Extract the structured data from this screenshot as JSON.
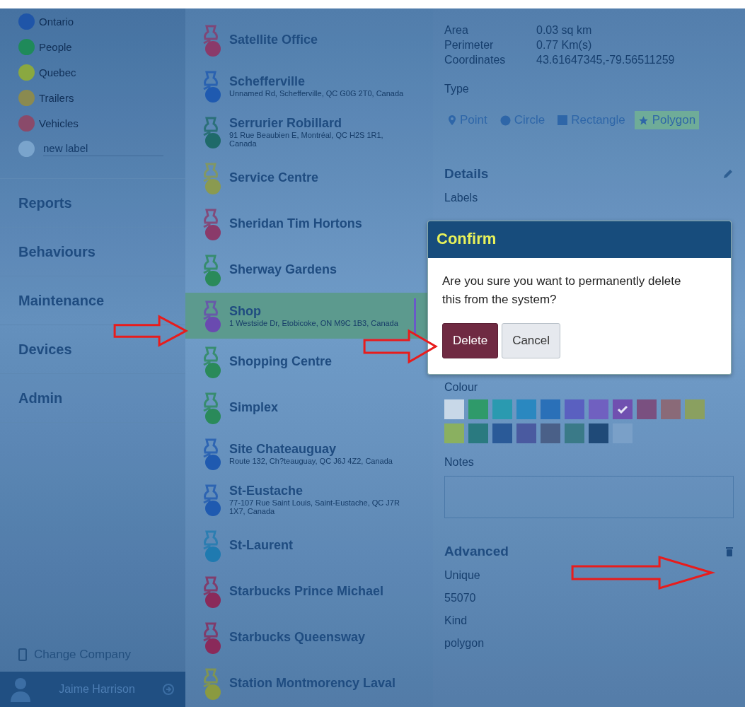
{
  "labels": [
    {
      "name": "Ontario",
      "color": "#1f55a8"
    },
    {
      "name": "People",
      "color": "#1f8a5a"
    },
    {
      "name": "Quebec",
      "color": "#8aa840"
    },
    {
      "name": "Trailers",
      "color": "#8a8a50"
    },
    {
      "name": "Vehicles",
      "color": "#8a4a6a"
    }
  ],
  "new_label": {
    "placeholder": "new label"
  },
  "nav": [
    "Reports",
    "Behaviours",
    "Maintenance",
    "Devices",
    "Admin"
  ],
  "change_company": "Change Company",
  "user": {
    "name": "Jaime Harrison"
  },
  "places": [
    {
      "name": "Satellite Office",
      "color": "#8a3a6a",
      "selected": false
    },
    {
      "name": "Schefferville",
      "address": "Unnamed Rd, Schefferville, QC G0G 2T0, Canada",
      "color": "#1f5ab0",
      "selected": false
    },
    {
      "name": "Serrurier Robillard",
      "address": "91 Rue Beaubien E, Montréal, QC H2S 1R1, Canada",
      "color": "#1f6a6a",
      "selected": false
    },
    {
      "name": "Service Centre",
      "color": "#8a9a50",
      "selected": false
    },
    {
      "name": "Sheridan Tim Hortons",
      "color": "#8a3a6a",
      "selected": false
    },
    {
      "name": "Sherway Gardens",
      "color": "#2a8a5a",
      "selected": false
    },
    {
      "name": "Shop",
      "address": "1 Westside Dr, Etobicoke, ON M9C 1B3, Canada",
      "color": "#6a4ab0",
      "selected": true
    },
    {
      "name": "Shopping Centre",
      "color": "#2a8a5a",
      "selected": false
    },
    {
      "name": "Simplex",
      "color": "#2a8a5a",
      "selected": false
    },
    {
      "name": "Site Chateauguay",
      "address": "Route 132, Ch?teauguay, QC J6J 4Z2, Canada",
      "color": "#1f5ab0",
      "selected": false
    },
    {
      "name": "St-Eustache",
      "address": "77-107 Rue Saint Louis, Saint-Eustache, QC J7R 1X7, Canada",
      "color": "#1f5ab0",
      "selected": false
    },
    {
      "name": "St-Laurent",
      "color": "#1f7ab0",
      "selected": false
    },
    {
      "name": "Starbucks Prince Michael",
      "color": "#8a2a5a",
      "selected": false
    },
    {
      "name": "Starbucks Queensway",
      "color": "#8a2a5a",
      "selected": false
    },
    {
      "name": "Station Montmorency Laval",
      "color": "#8a9a40",
      "selected": false
    }
  ],
  "stats": [
    {
      "label": "Area",
      "value": "0.03 sq km"
    },
    {
      "label": "Perimeter",
      "value": "0.77 Km(s)"
    },
    {
      "label": "Coordinates",
      "value": "43.61647345,-79.56511259"
    }
  ],
  "type": {
    "label": "Type",
    "options": [
      {
        "label": "Point",
        "kind": "pin",
        "selected": false
      },
      {
        "label": "Circle",
        "kind": "circle",
        "selected": false
      },
      {
        "label": "Rectangle",
        "kind": "square",
        "selected": false
      },
      {
        "label": "Polygon",
        "kind": "star",
        "selected": true
      }
    ]
  },
  "details": {
    "title": "Details",
    "labels_label": "Labels",
    "colour_label": "Colour",
    "swatches": [
      {
        "color": "#c8d8e8",
        "selected": false
      },
      {
        "color": "#2f9a6a",
        "selected": false
      },
      {
        "color": "#2a9ab0",
        "selected": false
      },
      {
        "color": "#2a88c0",
        "selected": false
      },
      {
        "color": "#2a70b8",
        "selected": false
      },
      {
        "color": "#5a60c0",
        "selected": false
      },
      {
        "color": "#7060c0",
        "selected": false
      },
      {
        "color": "#7050b0",
        "selected": true
      },
      {
        "color": "#7a5080",
        "selected": false
      },
      {
        "color": "#8a6a78",
        "selected": false
      },
      {
        "color": "#8aa060",
        "selected": false
      },
      {
        "color": "#8ab060",
        "selected": false
      },
      {
        "color": "#2a7a80",
        "selected": false
      },
      {
        "color": "#2a5a98",
        "selected": false
      },
      {
        "color": "#4a5aa0",
        "selected": false
      },
      {
        "color": "#4a6088",
        "selected": false
      },
      {
        "color": "#3a7a88",
        "selected": false
      },
      {
        "color": "#1f4a78",
        "selected": false
      },
      {
        "color": "#7aa0c8",
        "selected": false
      }
    ],
    "notes_label": "Notes"
  },
  "advanced": {
    "title": "Advanced",
    "fields": [
      {
        "label": "Unique",
        "value": "55070"
      },
      {
        "label": "Kind",
        "value": "polygon"
      }
    ]
  },
  "dialog": {
    "title": "Confirm",
    "message": "Are you sure you want to permanently delete this from the system?",
    "buttons": [
      {
        "label": "Delete",
        "kind": "danger"
      },
      {
        "label": "Cancel",
        "kind": "default"
      }
    ]
  }
}
